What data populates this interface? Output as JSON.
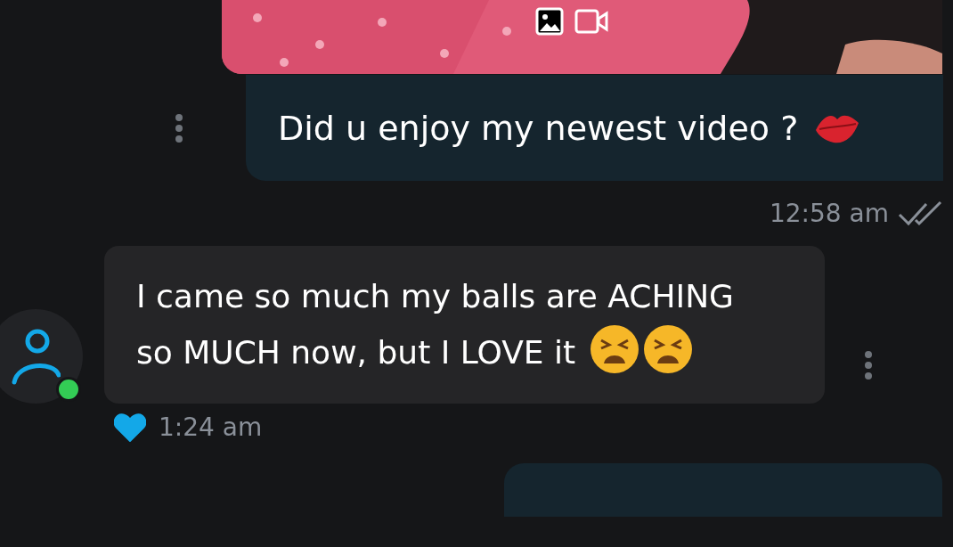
{
  "messages": [
    {
      "kind": "outgoing",
      "attachment": {
        "kind": "picture"
      },
      "text": "Did u enjoy my newest video ?",
      "emoji": [
        {
          "kind": "kiss"
        }
      ],
      "time": "12:58 am",
      "read": true
    },
    {
      "kind": "incoming",
      "text": "I came so much my balls are ACHING so MUCH now, but I LOVE it",
      "emoji": [
        {
          "kind": "tired"
        },
        {
          "kind": "tired"
        }
      ],
      "time": "1:24 am",
      "liked": true,
      "sender_online": true
    },
    {
      "kind": "outgoing_partial"
    }
  ]
}
